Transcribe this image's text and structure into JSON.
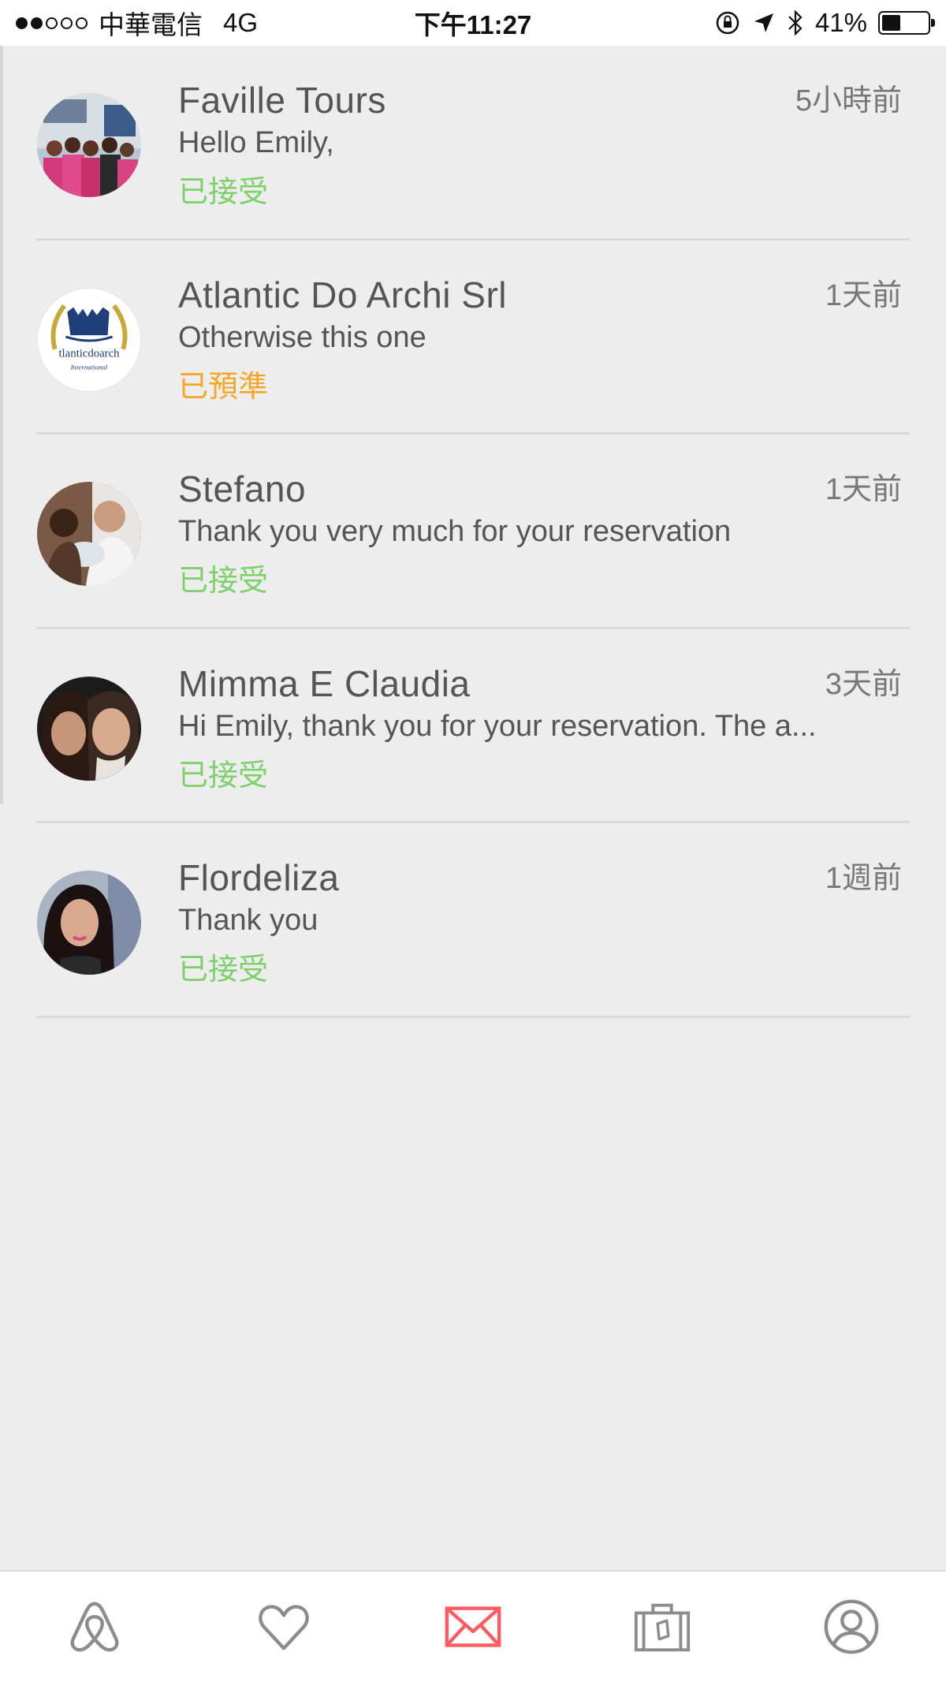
{
  "status_bar": {
    "carrier": "中華電信",
    "network": "4G",
    "time": "下午11:27",
    "battery": "41%",
    "battery_level": 0.41,
    "signal_bars": 2
  },
  "colors": {
    "accepted": "#7ed06b",
    "pre_approved": "#f5a623",
    "accent": "#ff5a5f",
    "tab_inactive": "#8c8c8c"
  },
  "messages": [
    {
      "name": "Faville Tours",
      "preview": "Hello Emily,",
      "status": "已接受",
      "status_type": "accepted",
      "time": "5小時前",
      "avatar": "group-photo"
    },
    {
      "name": "Atlantic Do Archi Srl",
      "preview": "Otherwise this one",
      "status": "已預準",
      "status_type": "pre_approved",
      "time": "1天前",
      "avatar": "logo",
      "avatar_text": "tlanticdoarch",
      "avatar_subtext": "International"
    },
    {
      "name": "Stefano",
      "preview": "Thank you very much for your reservation",
      "status": "已接受",
      "status_type": "accepted",
      "time": "1天前",
      "avatar": "portrait"
    },
    {
      "name": "Mimma E Claudia",
      "preview": "Hi Emily, thank you for your reservation. The a...",
      "status": "已接受",
      "status_type": "accepted",
      "time": "3天前",
      "avatar": "portrait"
    },
    {
      "name": "Flordeliza",
      "preview": "Thank you",
      "status": "已接受",
      "status_type": "accepted",
      "time": "1週前",
      "avatar": "portrait"
    }
  ],
  "tabs": [
    {
      "icon": "airbnb-logo-icon",
      "active": false
    },
    {
      "icon": "heart-icon",
      "active": false
    },
    {
      "icon": "mail-icon",
      "active": true
    },
    {
      "icon": "suitcase-icon",
      "active": false
    },
    {
      "icon": "profile-icon",
      "active": false
    }
  ]
}
